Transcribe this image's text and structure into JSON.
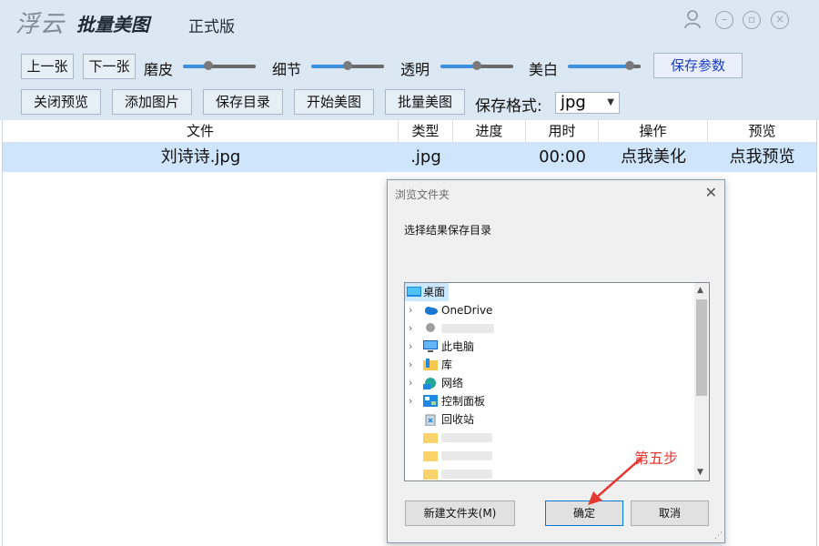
{
  "header": {
    "logo": "浮云",
    "title": "批量美图",
    "edition": "正式版"
  },
  "toolbar": {
    "prev": "上一张",
    "next": "下一张",
    "sliders": [
      {
        "label": "磨皮",
        "level": 0.35
      },
      {
        "label": "细节",
        "level": 0.5
      },
      {
        "label": "透明",
        "level": 0.5
      },
      {
        "label": "美白",
        "level": 0.85
      }
    ],
    "save_params": "保存参数",
    "close_preview": "关闭预览",
    "add_image": "添加图片",
    "save_dir": "保存目录",
    "start": "开始美图",
    "batch": "批量美图",
    "format_label": "保存格式:",
    "format_value": "jpg"
  },
  "table": {
    "headers": [
      "文件",
      "类型",
      "进度",
      "用时",
      "操作",
      "预览"
    ],
    "rows": [
      {
        "file": "刘诗诗.jpg",
        "type": ".jpg",
        "progress": "",
        "time": "00:00",
        "action": "点我美化",
        "preview": "点我预览"
      }
    ]
  },
  "dialog": {
    "title": "浏览文件夹",
    "instruction": "选择结果保存目录",
    "tree": [
      "桌面",
      "OneDrive",
      "此电脑",
      "库",
      "网络",
      "控制面板",
      "回收站"
    ],
    "new_folder": "新建文件夹(M)",
    "ok": "确定",
    "cancel": "取消"
  },
  "annotation": "第五步",
  "colors": {
    "accent": "#3d8fe0",
    "selected_row": "#cfe5fb",
    "toolbar": "#dbe7f3",
    "annotation": "#e53935"
  }
}
